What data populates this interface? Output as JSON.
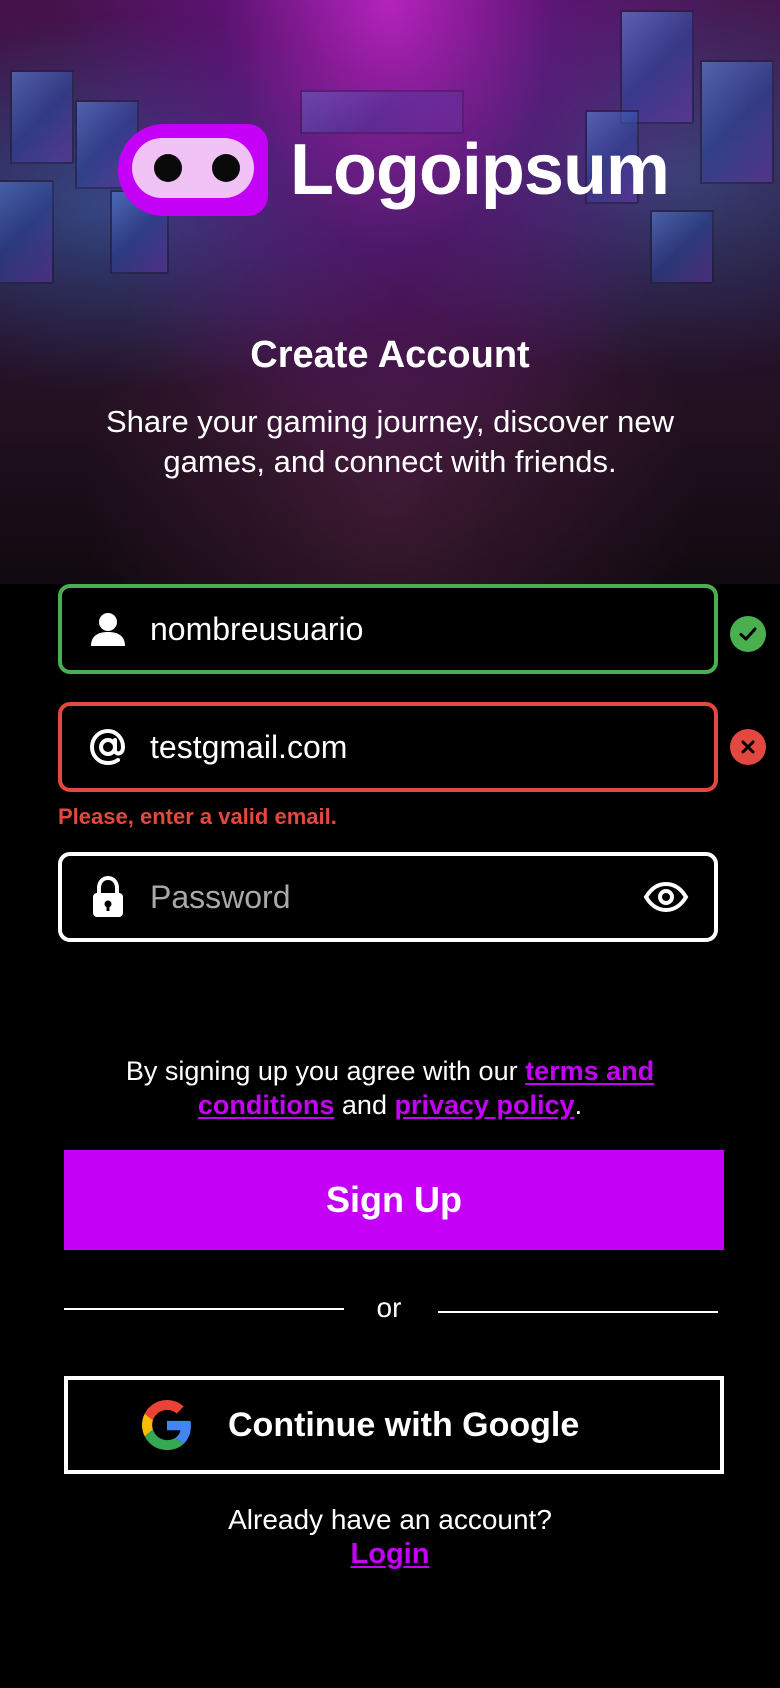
{
  "app": {
    "logo_text": "Logoipsum",
    "brand_color": "#c500f6"
  },
  "hero": {
    "title": "Create Account",
    "subtitle": "Share your gaming journey, discover new games, and connect with friends."
  },
  "form": {
    "username": {
      "value": "nombreusuario",
      "icon": "user-icon",
      "status": "valid",
      "status_icon": "check-circle-icon",
      "border_color": "#4ab04f"
    },
    "email": {
      "value": "testgmail.com",
      "icon": "at-sign-icon",
      "status": "invalid",
      "status_icon": "error-circle-icon",
      "border_color": "#e2483f",
      "error_message": "Please, enter a valid email."
    },
    "password": {
      "value": "",
      "placeholder": "Password",
      "icon": "lock-icon",
      "toggle_icon": "eye-icon"
    }
  },
  "terms": {
    "prefix": "By signing up you agree with our ",
    "terms_link": "terms and conditions",
    "middle": " and ",
    "privacy_link": "privacy policy",
    "suffix": "."
  },
  "actions": {
    "signup_label": "Sign Up",
    "or_label": "or",
    "google_label": "Continue with Google",
    "google_icon": "google-icon"
  },
  "footer": {
    "already_text": "Already have an account?",
    "login_label": "Login"
  },
  "colors": {
    "success": "#4ab04f",
    "error": "#e2483f",
    "background": "#000000"
  }
}
